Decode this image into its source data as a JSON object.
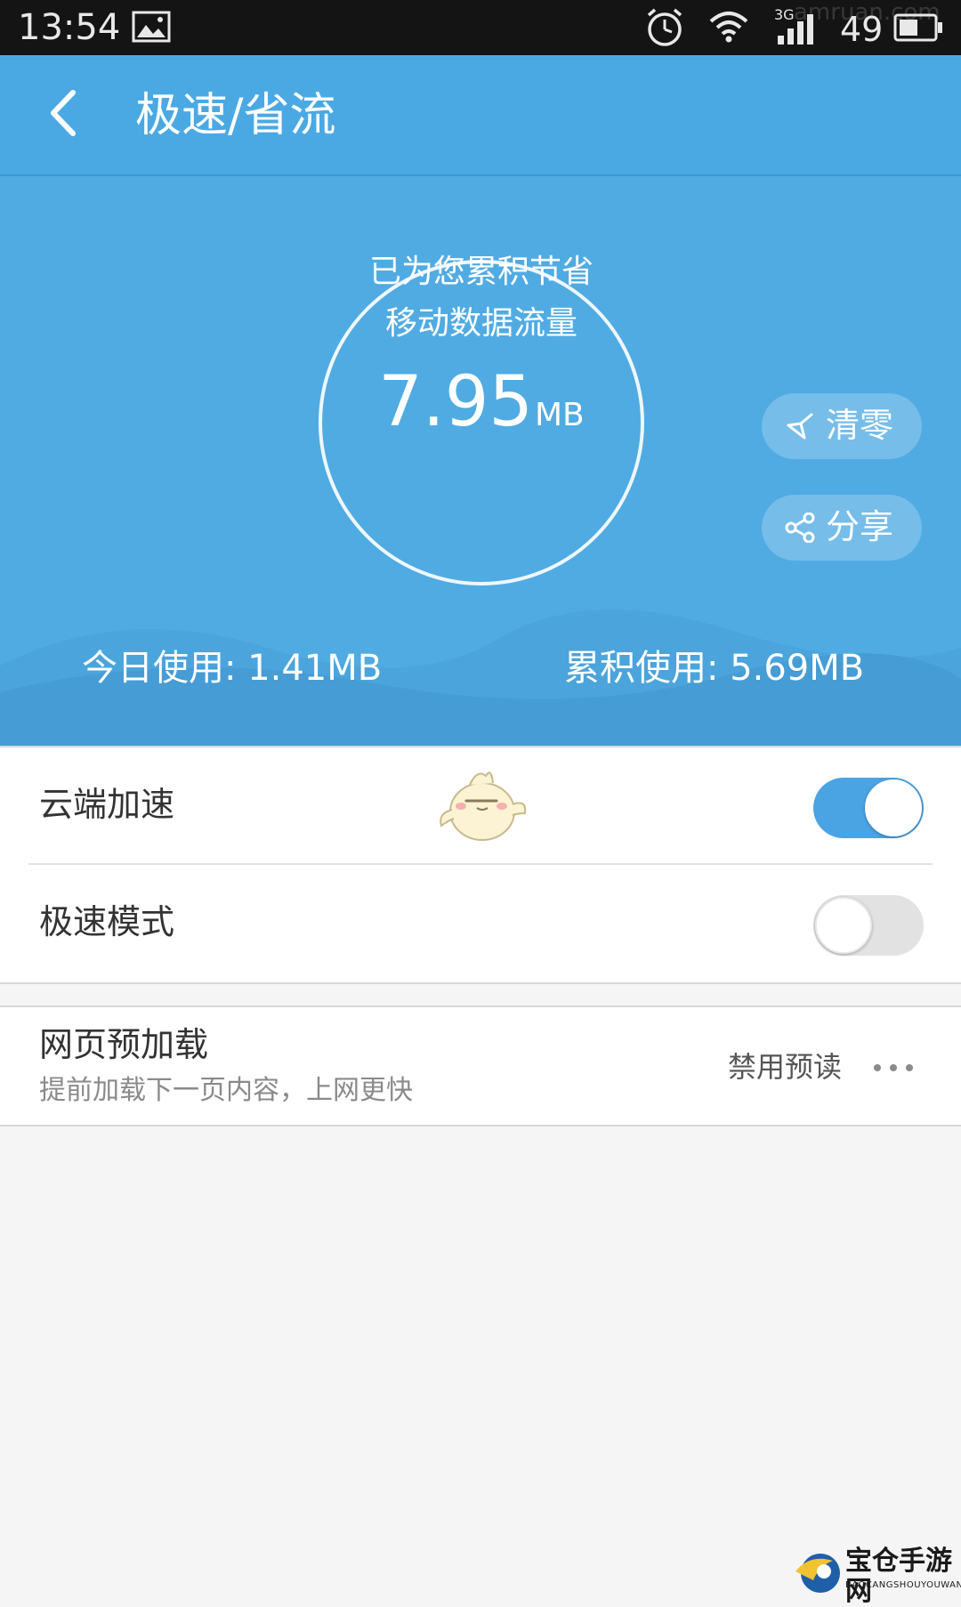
{
  "status_bar": {
    "time": "13:54",
    "network_type": "3G",
    "signal_level": "49",
    "watermark": "amruan.com",
    "icons": [
      "image-icon",
      "alarm-icon",
      "wifi-icon",
      "signal-icon",
      "battery-icon"
    ]
  },
  "header": {
    "title": "极速/省流",
    "back_icon": "chevron-left-icon"
  },
  "summary": {
    "line1": "已为您累积节省",
    "line2": "移动数据流量",
    "saved_value": "7.95",
    "saved_unit": "MB",
    "clear_label": "清零",
    "clear_icon": "broom-icon",
    "share_label": "分享",
    "share_icon": "share-icon",
    "today_usage": "今日使用: 1.41MB",
    "total_usage": "累积使用: 5.69MB"
  },
  "settings": {
    "cloud_accel": {
      "label": "云端加速",
      "enabled": true
    },
    "turbo_mode": {
      "label": "极速模式",
      "enabled": false
    },
    "preload": {
      "title": "网页预加载",
      "subtitle": "提前加载下一页内容，上网更快",
      "value": "禁用预读",
      "more_icon": "more-dots-icon"
    }
  },
  "watermark": {
    "name": "宝仓手游网",
    "sub": "BAOCANGSHOUYOUWANG"
  },
  "colors": {
    "primary": "#4aa9e3",
    "toggle_on": "#4aa3e2",
    "toggle_off": "#e2e2e2",
    "background": "#f5f5f5"
  }
}
